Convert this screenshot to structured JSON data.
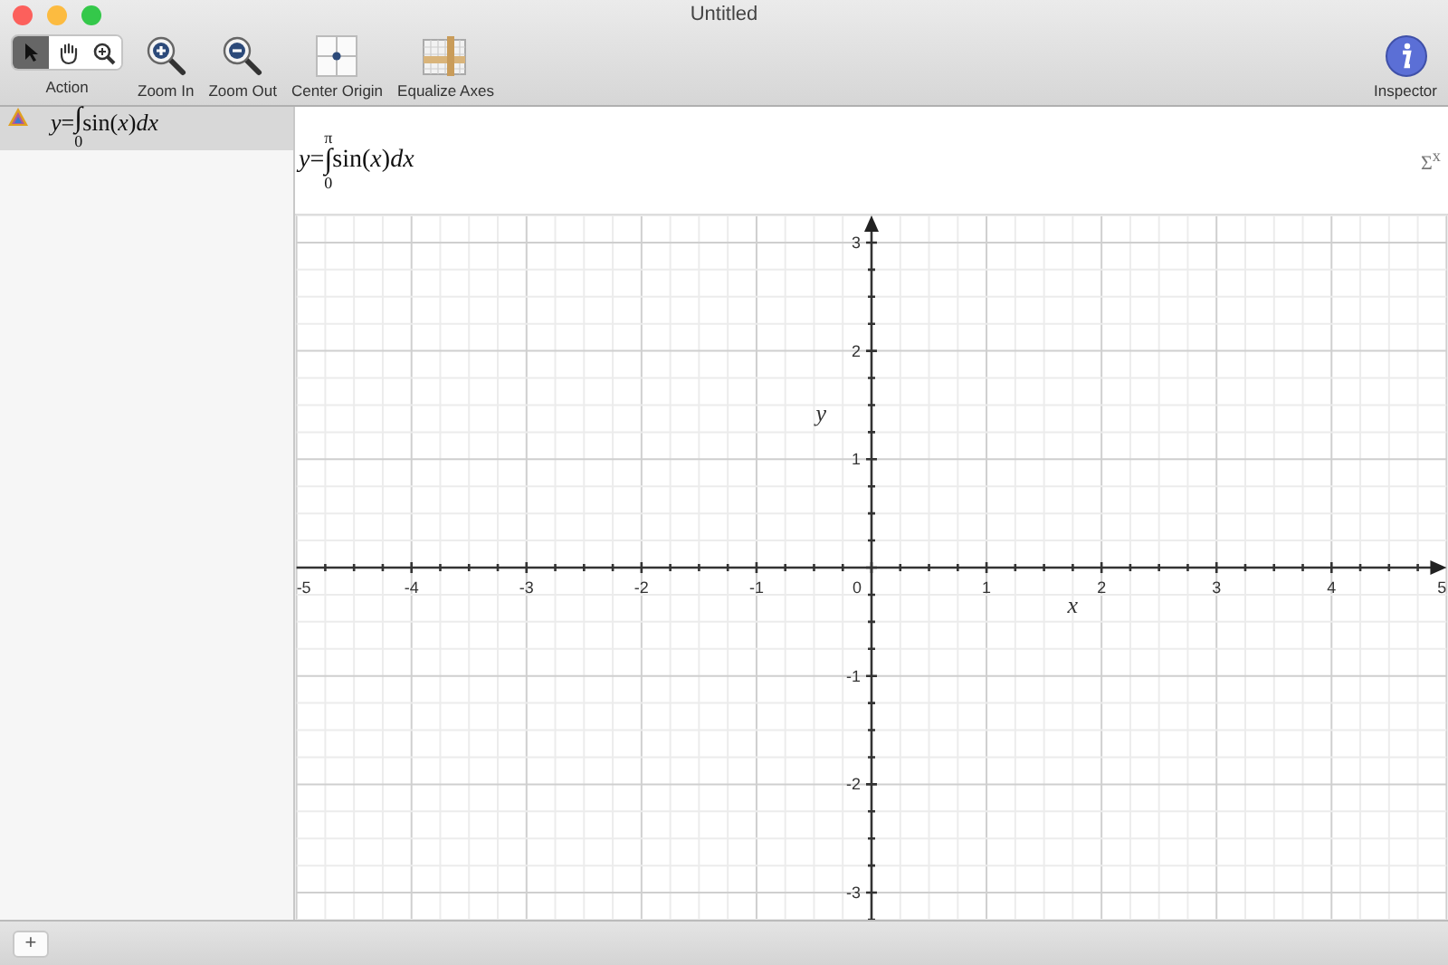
{
  "window": {
    "title": "Untitled"
  },
  "toolbar": {
    "tools": [
      {
        "kind": "pointer",
        "selected": true
      },
      {
        "kind": "hand",
        "selected": false
      },
      {
        "kind": "zoom",
        "selected": false
      }
    ],
    "tools_label": "Action",
    "buttons": [
      {
        "kind": "zoom_in",
        "label": "Zoom In"
      },
      {
        "kind": "zoom_out",
        "label": "Zoom Out"
      },
      {
        "kind": "center",
        "label": "Center Origin"
      },
      {
        "kind": "equalize",
        "label": "Equalize Axes"
      }
    ],
    "inspector": {
      "label": "Inspector"
    }
  },
  "sidebar": {
    "items": [
      {
        "lhs": "*y*=",
        "integral": "∫",
        "lower": "0",
        "integrand": "sin(*x*)*dx*",
        "selected": true
      }
    ]
  },
  "equation": {
    "lhs": "*y*=",
    "integral": "∫",
    "upper": "π",
    "lower": "0",
    "integrand": "sin(*x*)*dx*",
    "menu": "Σ$^{x}$"
  },
  "graph": {
    "x_label": "x",
    "y_label": "y",
    "x_ticks": [
      "-5",
      "-4",
      "-3",
      "-2",
      "-1",
      "0",
      "1",
      "2",
      "3",
      "4",
      "5"
    ],
    "y_ticks": [
      "3",
      "2",
      "1",
      "-1",
      "-2",
      "-3"
    ]
  },
  "bottom_bar": {
    "add_button": "+"
  }
}
